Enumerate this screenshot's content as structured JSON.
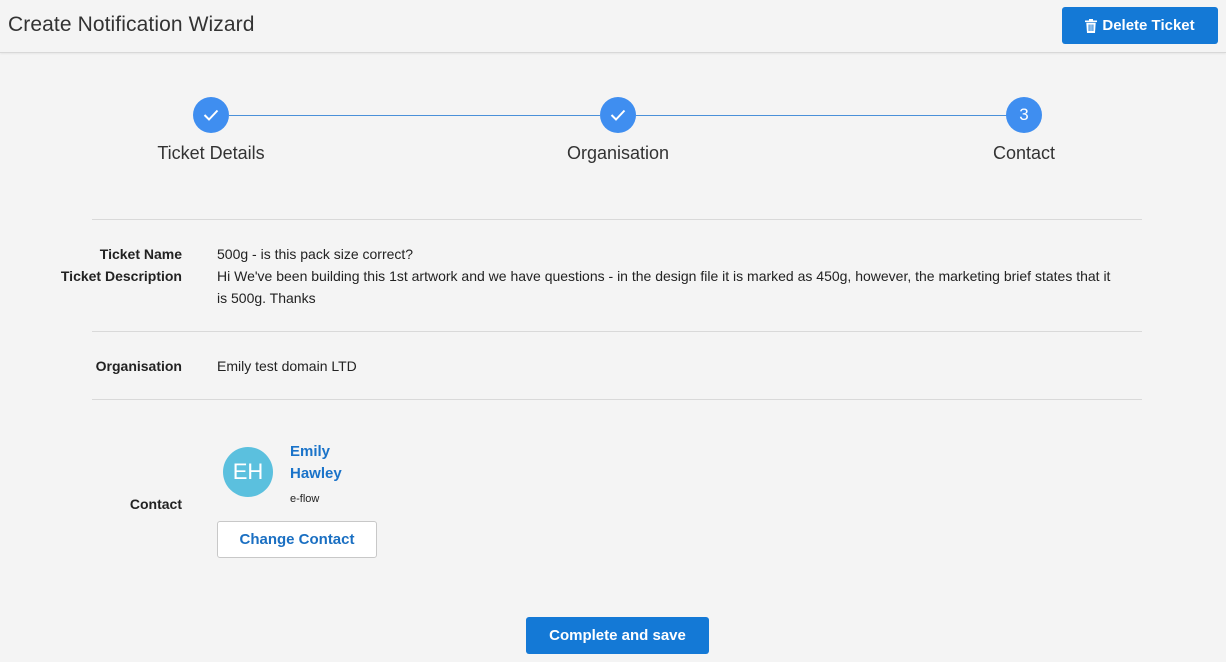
{
  "header": {
    "title": "Create Notification Wizard",
    "delete_label": "Delete Ticket"
  },
  "stepper": {
    "steps": [
      {
        "label": "Ticket Details",
        "state": "complete",
        "marker": "✓"
      },
      {
        "label": "Organisation",
        "state": "complete",
        "marker": "✓"
      },
      {
        "label": "Contact",
        "state": "current",
        "marker": "3"
      }
    ]
  },
  "ticket": {
    "name_label": "Ticket Name",
    "name_value": "500g - is this pack size correct?",
    "description_label": "Ticket Description",
    "description_value": "Hi We've been building this 1st artwork and we have questions - in the design file it is marked as 450g, however, the marketing brief states that it is 500g. Thanks"
  },
  "organisation": {
    "label": "Organisation",
    "value": "Emily test domain LTD"
  },
  "contact": {
    "label": "Contact",
    "initials": "EH",
    "name": "Emily Hawley",
    "org": "e-flow",
    "change_label": "Change Contact"
  },
  "footer": {
    "complete_label": "Complete and save"
  },
  "colors": {
    "primary": "#1479d6",
    "step": "#3f8ef0",
    "avatar": "#5bc0de",
    "link": "#1a73c9"
  },
  "icons": {
    "delete": "trash-icon",
    "step_done": "check-icon"
  }
}
